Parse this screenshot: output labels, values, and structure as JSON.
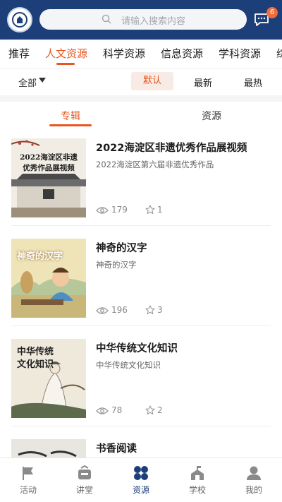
{
  "header": {
    "search_placeholder": "请输入搜索内容",
    "message_badge": "6"
  },
  "category_tabs": [
    {
      "label": "推荐"
    },
    {
      "label": "人文资源",
      "active": true
    },
    {
      "label": "科学资源"
    },
    {
      "label": "信息资源"
    },
    {
      "label": "学科资源"
    },
    {
      "label": "综"
    }
  ],
  "filter": {
    "all_label": "全部",
    "sort_options": [
      "默认",
      "最新",
      "最热"
    ],
    "selected_sort": "默认"
  },
  "sub_tabs": [
    {
      "label": "专辑",
      "active": true
    },
    {
      "label": "资源"
    }
  ],
  "items": [
    {
      "title": "2022海淀区非遗优秀作品展视频",
      "subtitle": "2022海淀区第六届非遗优秀作品",
      "views": "179",
      "favorites": "1",
      "cover_text": [
        "2022海淀区非遗",
        "优秀作品展视频"
      ]
    },
    {
      "title": "神奇的汉字",
      "subtitle": "神奇的汉字",
      "views": "196",
      "favorites": "3",
      "cover_text": [
        "神奇的汉字"
      ]
    },
    {
      "title": "中华传统文化知识",
      "subtitle": "中华传统文化知识",
      "views": "78",
      "favorites": "2",
      "cover_text": [
        "中华传统",
        "文化知识"
      ]
    },
    {
      "title": "书香阅读",
      "subtitle": "",
      "views": "",
      "favorites": "",
      "cover_text": []
    }
  ],
  "bottom_nav": [
    {
      "label": "活动",
      "icon": "flag-icon"
    },
    {
      "label": "讲堂",
      "icon": "classroom-icon"
    },
    {
      "label": "资源",
      "icon": "resources-icon",
      "active": true
    },
    {
      "label": "学校",
      "icon": "school-icon"
    },
    {
      "label": "我的",
      "icon": "profile-icon"
    }
  ],
  "colors": {
    "header_bg": "#1c3f7a",
    "accent": "#e8561e",
    "badge": "#f26b3a",
    "nav_active": "#1c3f7a"
  }
}
